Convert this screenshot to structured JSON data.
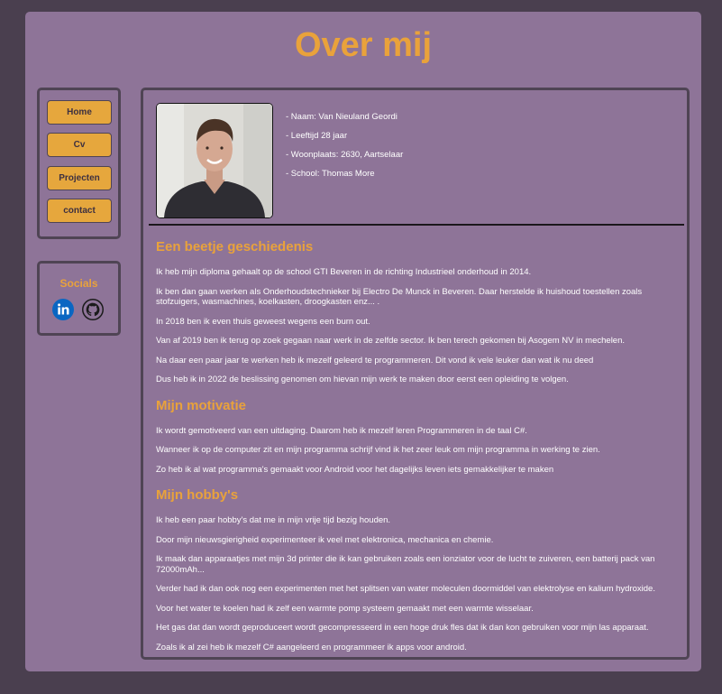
{
  "page": {
    "title": "Over mij"
  },
  "nav": {
    "items": [
      {
        "label": "Home"
      },
      {
        "label": "Cv"
      },
      {
        "label": "Projecten"
      },
      {
        "label": "contact"
      }
    ]
  },
  "socials": {
    "title": "Socials",
    "linkedin_icon": "linkedin-icon",
    "github_icon": "github-icon"
  },
  "profile": {
    "photo": "profile-photo",
    "name": "- Naam: Van Nieuland Geordi",
    "age": "- Leeftijd 28 jaar",
    "residence": "- Woonplaats: 2630, Aartselaar",
    "school": "- School: Thomas More"
  },
  "sections": [
    {
      "heading": "Een beetje geschiedenis",
      "paragraphs": [
        "Ik heb mijn diploma gehaalt op de school GTI Beveren in de richting Industrieel onderhoud in 2014.",
        "Ik ben dan gaan werken als Onderhoudstechnieker bij Electro De Munck in Beveren. Daar herstelde ik huishoud toestellen zoals stofzuigers, wasmachines, koelkasten, droogkasten enz... .",
        "In 2018 ben ik even thuis geweest wegens een burn out.",
        "Van af 2019 ben ik terug op zoek gegaan naar werk in de zelfde sector. Ik ben terech gekomen bij Asogem NV in mechelen.",
        "Na daar een paar jaar te werken heb ik mezelf geleerd te programmeren. Dit vond ik vele leuker dan wat ik nu deed",
        "Dus heb ik in 2022 de beslissing genomen om hievan mijn werk te maken door eerst een opleiding te volgen."
      ]
    },
    {
      "heading": "Mijn motivatie",
      "paragraphs": [
        "Ik wordt gemotiveerd van een uitdaging. Daarom heb ik mezelf leren Programmeren in de taal C#.",
        "Wanneer ik op de computer zit en mijn programma schrijf vind ik het zeer leuk om mijn programma in werking te zien.",
        "Zo heb ik al wat programma's gemaakt voor Android voor het dagelijks leven iets gemakkelijker te maken"
      ]
    },
    {
      "heading": "Mijn hobby's",
      "paragraphs": [
        "Ik heb een paar hobby's dat me in mijn vrije tijd bezig houden.",
        "Door mijn nieuwsgierigheid experimenteer ik veel met elektronica, mechanica en chemie.",
        "Ik maak dan apparaatjes met mijn 3d printer die ik kan gebruiken zoals een ionziator voor de lucht te zuiveren, een batterij pack van 72000mAh...",
        "Verder had ik dan ook nog een experimenten met het splitsen van water moleculen doormiddel van elektrolyse en kalium hydroxide.",
        "Voor het water te koelen had ik zelf een warmte pomp systeem gemaakt met een warmte wisselaar.",
        "Het gas dat dan wordt geproduceert wordt gecompresseerd in een hoge druk fles dat ik dan kon gebruiken voor mijn las apparaat.",
        "Zoals ik al zei heb ik mezelf C# aangeleerd en programmeer ik apps voor android."
      ]
    }
  ],
  "colors": {
    "background": "#4a3f4f",
    "panel": "#8e7498",
    "accent": "#e9a23b",
    "border": "#4f4454"
  }
}
